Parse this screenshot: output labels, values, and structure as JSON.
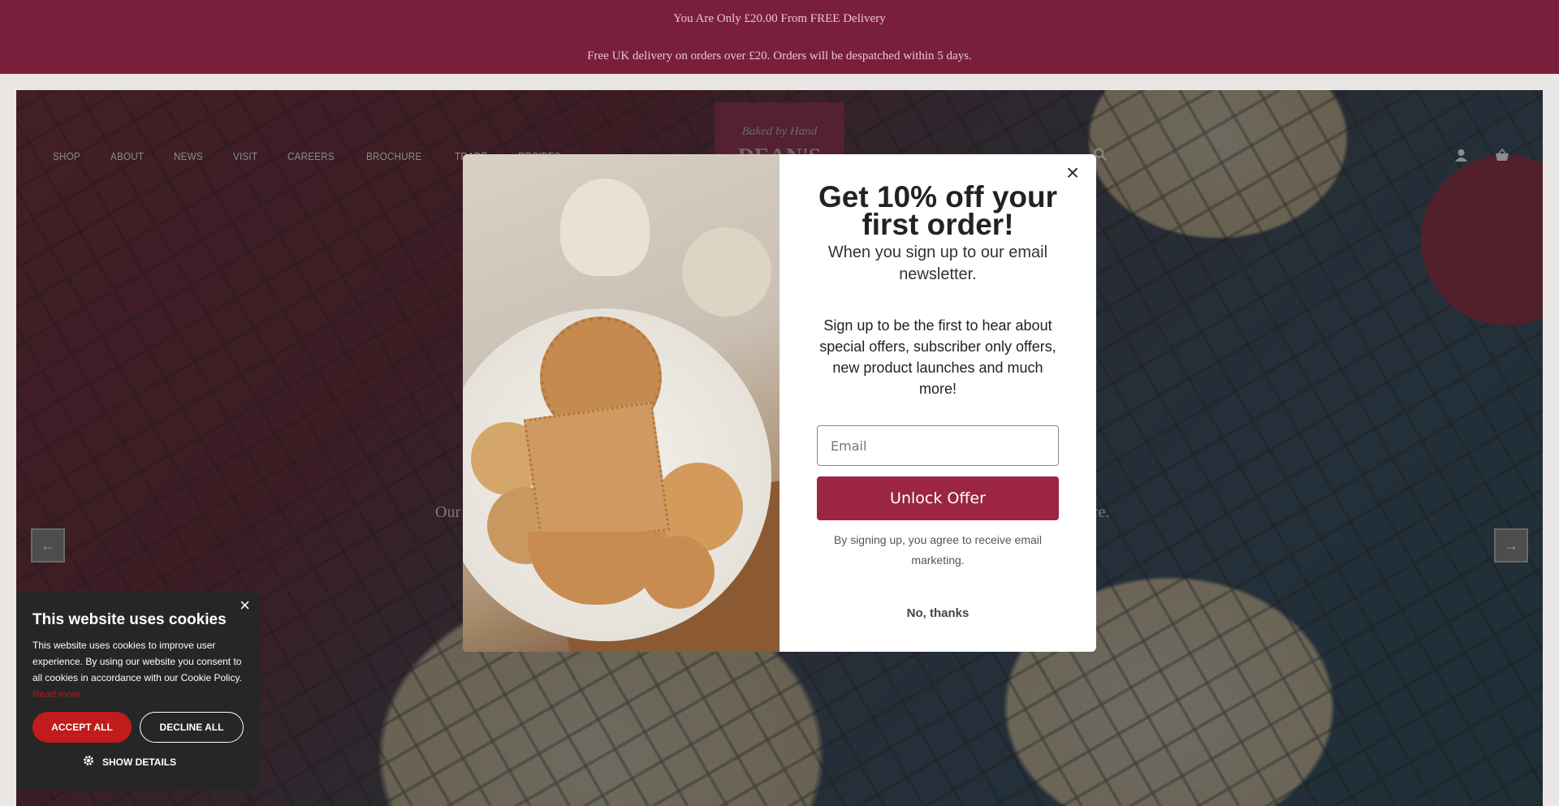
{
  "announcement": {
    "line1": "You Are Only £20.00 From FREE Delivery",
    "line2": "Free UK delivery on orders over £20. Orders will be despatched within 5 days."
  },
  "nav": {
    "items": [
      "SHOP",
      "ABOUT",
      "NEWS",
      "VISIT",
      "CAREERS",
      "BROCHURE",
      "TRADE",
      "RECIPES"
    ]
  },
  "header_icons": [
    "search-icon",
    "account-icon",
    "basket-icon"
  ],
  "hero": {
    "text_left": "Our",
    "text_right": "re.",
    "prev_arrow": "←",
    "next_arrow": "→"
  },
  "popup": {
    "title": "Get 10% off your first order!",
    "subtitle": "When you sign up to our email newsletter.",
    "body": "Sign up to be the first to hear about special offers, subscriber only offers, new product launches and much more!",
    "email_placeholder": "Email",
    "submit_label": "Unlock Offer",
    "legal": "By signing up, you agree to receive email marketing.",
    "decline_label": "No, thanks",
    "close_label": "×"
  },
  "cookie_banner": {
    "title": "This website uses cookies",
    "body": "This website uses cookies to improve user experience. By using our website you consent to all cookies in accordance with our Cookie Policy.",
    "read_more": "Read more",
    "accept_label": "ACCEPT ALL",
    "decline_label": "DECLINE ALL",
    "details_label": "SHOW DETAILS",
    "close_label": "×"
  },
  "colors": {
    "brand": "#7a1f3b",
    "button": "#9b2542",
    "cookie_accept": "#c11b1b",
    "cookie_bg": "#262626"
  }
}
